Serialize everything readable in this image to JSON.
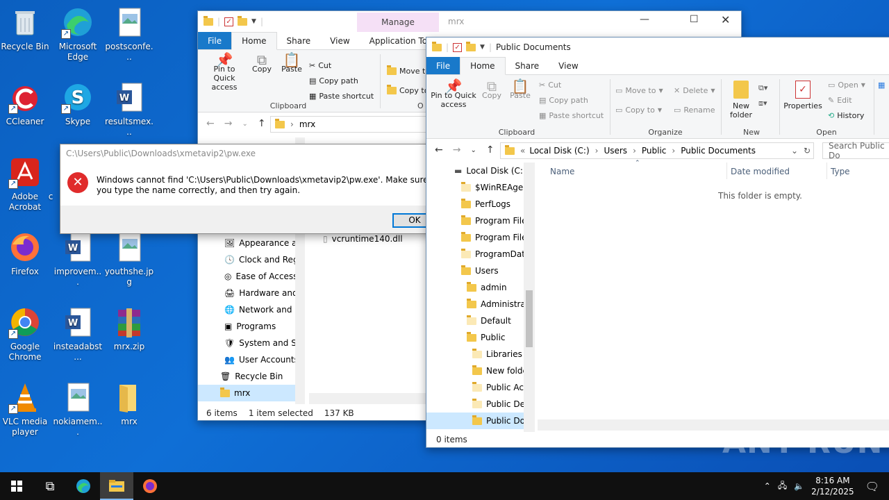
{
  "desktop_icons": [
    {
      "id": "recycle",
      "label": "Recycle Bin",
      "icon": "recycle-bin-icon"
    },
    {
      "id": "edge",
      "label": "Microsoft Edge",
      "icon": "edge-icon"
    },
    {
      "id": "posts",
      "label": "postsconfe...",
      "icon": "image-file-icon"
    },
    {
      "id": "ccleaner",
      "label": "CCleaner",
      "icon": "ccleaner-icon"
    },
    {
      "id": "skype",
      "label": "Skype",
      "icon": "skype-icon"
    },
    {
      "id": "results",
      "label": "resultsmex...",
      "icon": "word-doc-icon"
    },
    {
      "id": "acrobat",
      "label": "Adobe Acrobat",
      "icon": "acrobat-icon"
    },
    {
      "id": "acrobat2",
      "label": "c",
      "icon": "partial-icon"
    },
    {
      "id": "firefox",
      "label": "Firefox",
      "icon": "firefox-icon"
    },
    {
      "id": "improv",
      "label": "improvem...",
      "icon": "word-doc-icon"
    },
    {
      "id": "youth",
      "label": "youthshe.jpg",
      "icon": "image-file-icon"
    },
    {
      "id": "chrome",
      "label": "Google Chrome",
      "icon": "chrome-icon"
    },
    {
      "id": "instead",
      "label": "insteadabst...",
      "icon": "word-doc-icon"
    },
    {
      "id": "mrxzip",
      "label": "mrx.zip",
      "icon": "winrar-icon"
    },
    {
      "id": "vlc",
      "label": "VLC media player",
      "icon": "vlc-icon"
    },
    {
      "id": "nokia",
      "label": "nokiamem...",
      "icon": "image-file-icon"
    },
    {
      "id": "mrxfolder",
      "label": "mrx",
      "icon": "folder-icon"
    }
  ],
  "win1": {
    "title": "mrx",
    "context_tab": "Manage",
    "tabs": [
      "File",
      "Home",
      "Share",
      "View",
      "Application Tools"
    ],
    "clipboard": {
      "pin": "Pin to Quick access",
      "copy": "Copy",
      "paste": "Paste",
      "cut": "Cut",
      "copy_path": "Copy path",
      "paste_shortcut": "Paste shortcut",
      "group": "Clipboard"
    },
    "move_to": "Move to",
    "copy_to": "Copy to",
    "org_partial": "O",
    "address": "mrx",
    "tree": [
      "Appearance an",
      "Clock and Regi",
      "Ease of Access",
      "Hardware and",
      "Network and Ir",
      "Programs",
      "System and Se",
      "User Accounts",
      "Recycle Bin",
      "mrx"
    ],
    "file": "vcruntime140.dll",
    "status": {
      "items": "6 items",
      "selected": "1 item selected",
      "size": "137 KB"
    }
  },
  "dialog": {
    "title": "C:\\Users\\Public\\Downloads\\xmetavip2\\pw.exe",
    "message": "Windows cannot find 'C:\\Users\\Public\\Downloads\\xmetavip2\\pw.exe'. Make sure you type the name correctly, and then try again.",
    "ok": "OK"
  },
  "win2": {
    "title": "Public Documents",
    "tabs": [
      "File",
      "Home",
      "Share",
      "View"
    ],
    "clipboard": {
      "pin": "Pin to Quick access",
      "copy": "Copy",
      "paste": "Paste",
      "cut": "Cut",
      "copy_path": "Copy path",
      "paste_shortcut": "Paste shortcut",
      "group": "Clipboard"
    },
    "organize": {
      "move_to": "Move to",
      "copy_to": "Copy to",
      "delete": "Delete",
      "rename": "Rename",
      "group": "Organize"
    },
    "new": {
      "new_folder": "New folder",
      "group": "New"
    },
    "open": {
      "properties": "Properties",
      "open": "Open",
      "edit": "Edit",
      "history": "History",
      "group": "Open"
    },
    "breadcrumb": [
      "Local Disk (C:)",
      "Users",
      "Public",
      "Public Documents"
    ],
    "search_placeholder": "Search Public Do",
    "tree": [
      "Local Disk (C:)",
      "$WinREAgent",
      "PerfLogs",
      "Program Files",
      "Program Files",
      "ProgramData",
      "Users",
      "admin",
      "Administrat",
      "Default",
      "Public",
      "Libraries",
      "New folde",
      "Public Acc",
      "Public Des",
      "Public Doc"
    ],
    "columns": [
      "Name",
      "Date modified",
      "Type"
    ],
    "empty": "This folder is empty.",
    "status": "0 items"
  },
  "taskbar": {
    "time": "8:16 AM",
    "date": "2/12/2025"
  },
  "watermark": "ANY RUN"
}
